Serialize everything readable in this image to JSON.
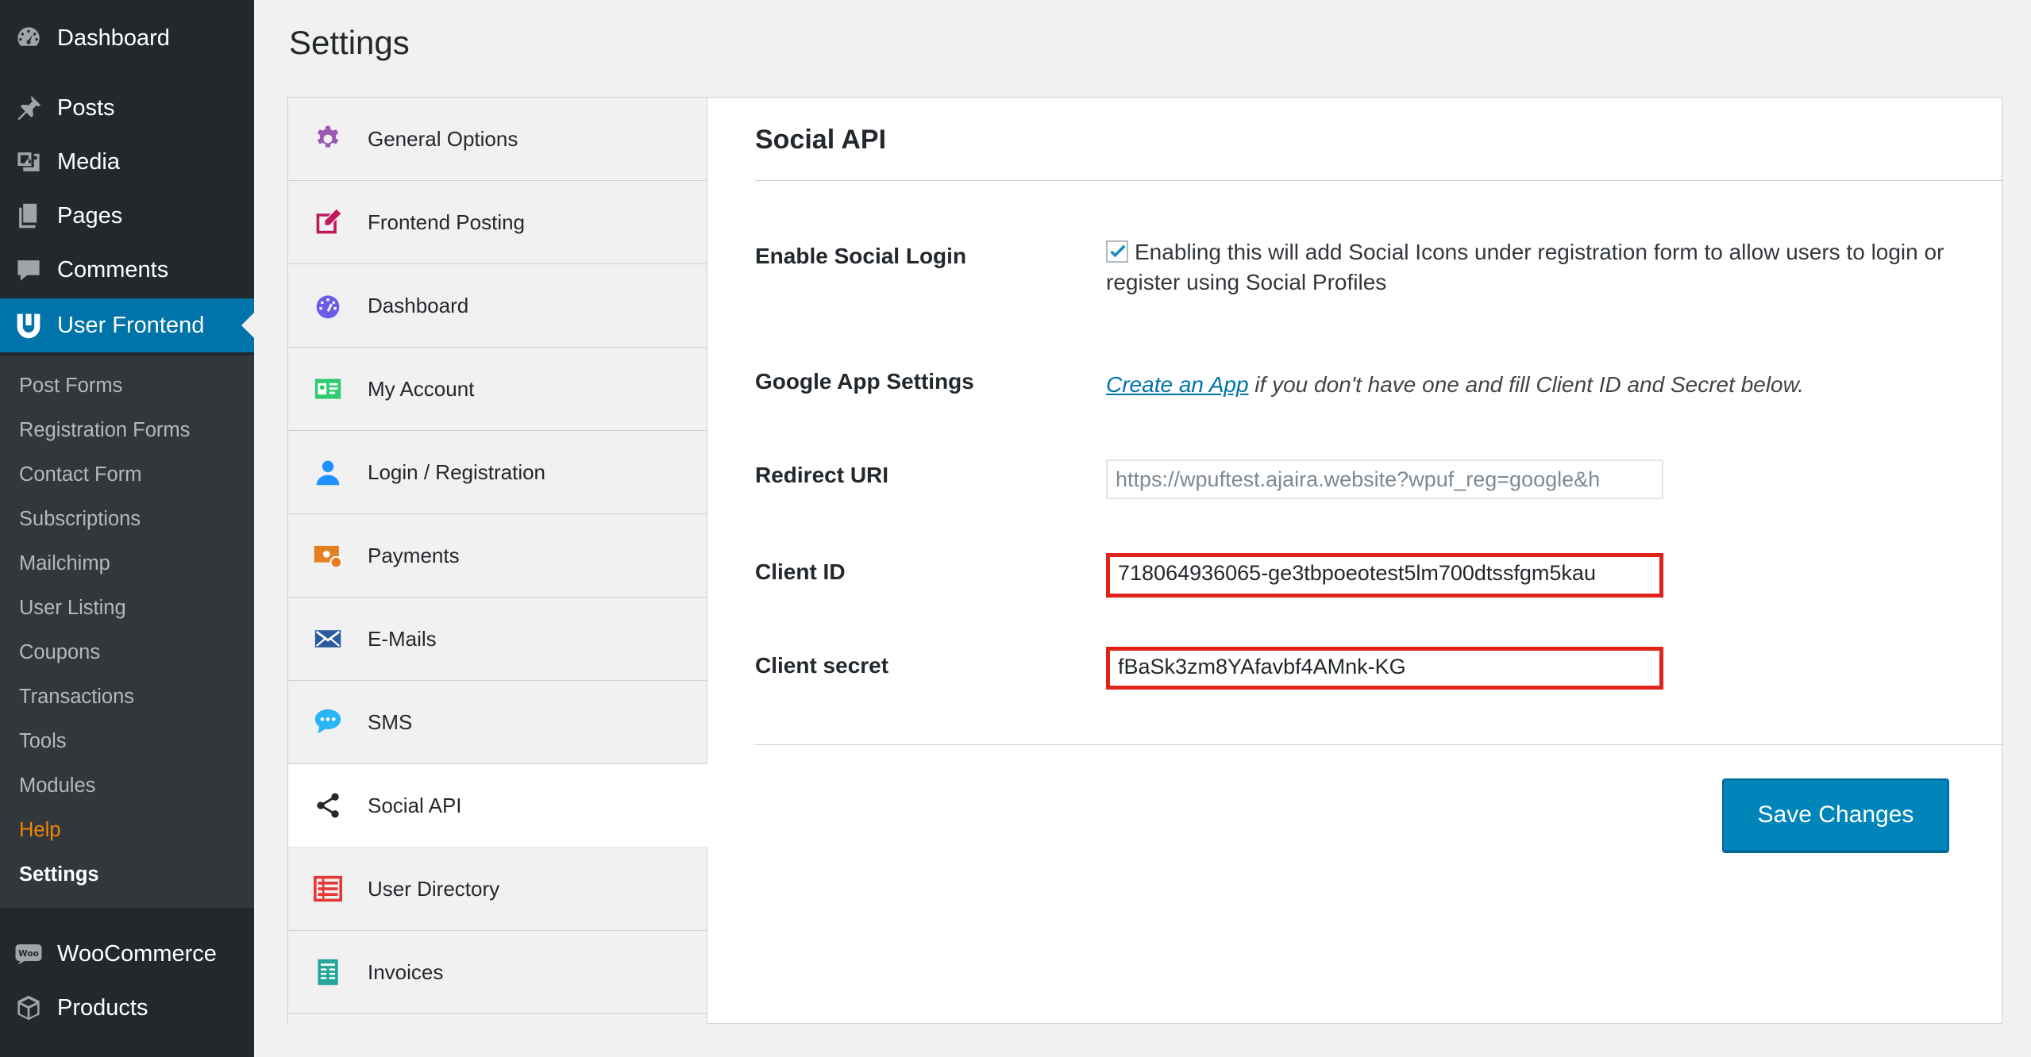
{
  "sidebar": {
    "top_items": [
      {
        "label": "Dashboard",
        "icon": "dashboard-icon"
      },
      {
        "label": "Posts",
        "icon": "pin-icon"
      },
      {
        "label": "Media",
        "icon": "media-icon"
      },
      {
        "label": "Pages",
        "icon": "pages-icon"
      },
      {
        "label": "Comments",
        "icon": "comment-icon"
      },
      {
        "label": "User Frontend",
        "icon": "wpuf-logo-icon"
      }
    ],
    "submenu": [
      "Post Forms",
      "Registration Forms",
      "Contact Form",
      "Subscriptions",
      "Mailchimp",
      "User Listing",
      "Coupons",
      "Transactions",
      "Tools",
      "Modules",
      "Help",
      "Settings"
    ],
    "bottom_items": [
      {
        "label": "WooCommerce",
        "icon": "woo-icon"
      },
      {
        "label": "Products",
        "icon": "box-icon"
      }
    ]
  },
  "page": {
    "title": "Settings"
  },
  "tabs": [
    {
      "label": "General Options",
      "icon": "gear-icon",
      "color": "#9b59b6"
    },
    {
      "label": "Frontend Posting",
      "icon": "edit-icon",
      "color": "#c2185b"
    },
    {
      "label": "Dashboard",
      "icon": "dashboard-icon",
      "color": "#6c5ce7"
    },
    {
      "label": "My Account",
      "icon": "id-card-icon",
      "color": "#2ecc71"
    },
    {
      "label": "Login / Registration",
      "icon": "user-icon",
      "color": "#1e90ff"
    },
    {
      "label": "Payments",
      "icon": "payment-icon",
      "color": "#e67e22"
    },
    {
      "label": "E-Mails",
      "icon": "envelope-icon",
      "color": "#2c5aa0"
    },
    {
      "label": "SMS",
      "icon": "chat-icon",
      "color": "#29b6f6"
    },
    {
      "label": "Social API",
      "icon": "share-icon",
      "color": "#23282d"
    },
    {
      "label": "User Directory",
      "icon": "list-icon",
      "color": "#e53935"
    },
    {
      "label": "Invoices",
      "icon": "invoice-icon",
      "color": "#26a69a"
    }
  ],
  "panel": {
    "title": "Social API",
    "enable_social_login": {
      "label": "Enable Social Login",
      "checked": true,
      "description": "Enabling this will add Social Icons under registration form to allow users to login or register using Social Profiles"
    },
    "google_app": {
      "label": "Google App Settings",
      "link_text": "Create an App",
      "description": " if you don't have one and fill Client ID and Secret below."
    },
    "redirect_uri": {
      "label": "Redirect URI",
      "value": "https://wpuftest.ajaira.website?wpuf_reg=google&h"
    },
    "client_id": {
      "label": "Client ID",
      "value": "718064936065-ge3tbpoeotest5lm700dtssfgm5kau"
    },
    "client_secret": {
      "label": "Client secret",
      "value": "fBaSk3zm8YAfavbf4AMnk-KG"
    },
    "save_label": "Save Changes"
  },
  "colors": {
    "sidebar_bg": "#23282d",
    "submenu_bg": "#32373c",
    "accent": "#0073aa",
    "button": "#0085ba",
    "highlight_border": "#e2231a",
    "help_link": "#f18500"
  }
}
